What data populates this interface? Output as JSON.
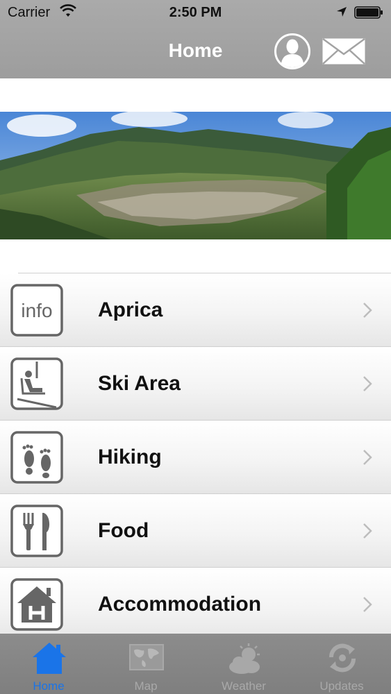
{
  "status_bar": {
    "carrier": "Carrier",
    "time": "2:50 PM",
    "wifi_icon": "wifi-icon",
    "location_icon": "location-arrow-icon",
    "battery_icon": "battery-icon"
  },
  "nav": {
    "title": "Home",
    "profile_icon": "user-profile-icon",
    "mail_icon": "mail-icon"
  },
  "banner": {
    "image": "mountain-village-panorama"
  },
  "menu": {
    "items": [
      {
        "label": "Aprica",
        "icon": "info-icon"
      },
      {
        "label": "Ski Area",
        "icon": "ski-lift-icon"
      },
      {
        "label": "Hiking",
        "icon": "footprints-icon"
      },
      {
        "label": "Food",
        "icon": "fork-knife-icon"
      },
      {
        "label": "Accommodation",
        "icon": "hotel-house-icon"
      }
    ]
  },
  "tabbar": {
    "tabs": [
      {
        "label": "Home",
        "icon": "home-icon",
        "active": true
      },
      {
        "label": "Map",
        "icon": "map-icon",
        "active": false
      },
      {
        "label": "Weather",
        "icon": "weather-icon",
        "active": false
      },
      {
        "label": "Updates",
        "icon": "updates-icon",
        "active": false
      }
    ]
  },
  "colors": {
    "nav_bg": "#a3a3a3",
    "tab_active": "#1a74e8",
    "tab_inactive": "#a9a9a9",
    "icon_gray": "#666666"
  }
}
